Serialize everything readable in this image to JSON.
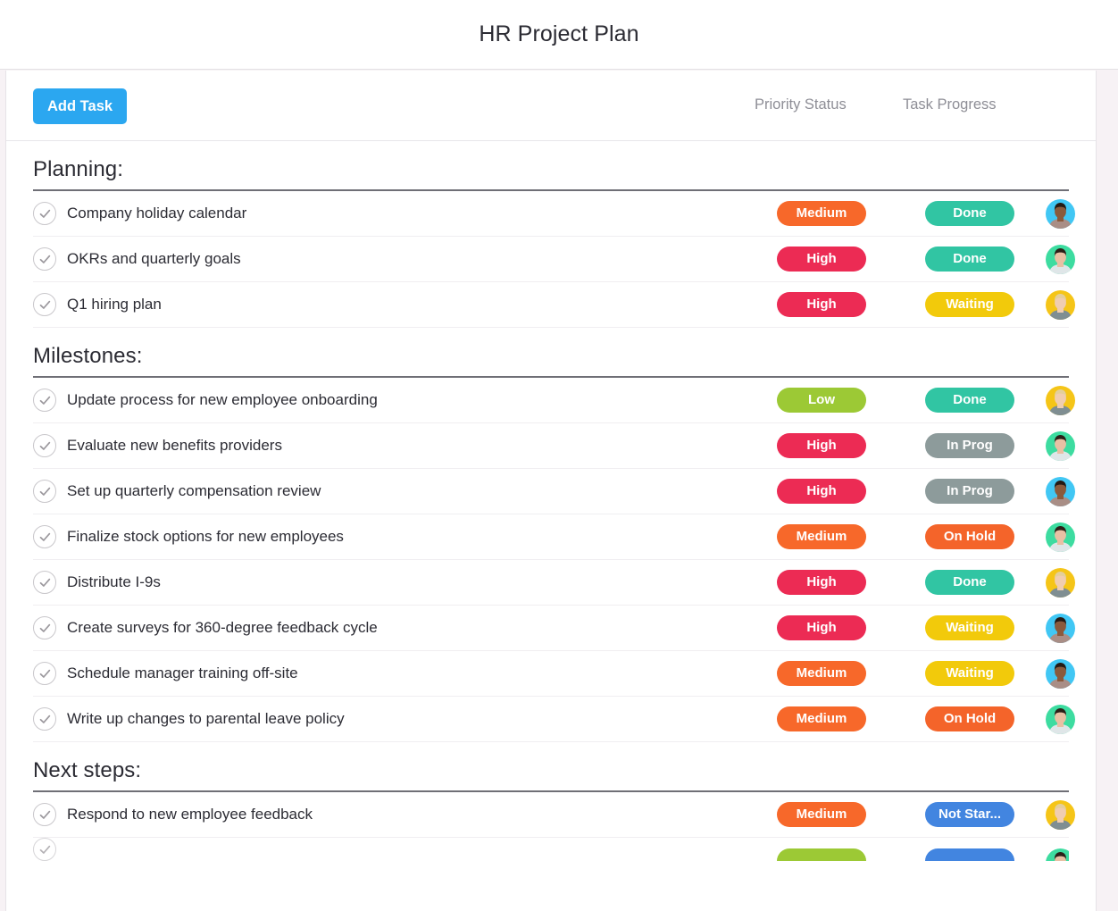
{
  "window": {
    "title": "HR Project Plan"
  },
  "toolbar": {
    "add_task_label": "Add Task",
    "column_priority": "Priority Status",
    "column_progress": "Task Progress"
  },
  "icons": {
    "check": "check-circle-icon"
  },
  "palette": {
    "accent_blue": "#2ba7f0",
    "priority_high": "#ec2b54",
    "priority_medium": "#f7682a",
    "priority_low": "#9cc935",
    "status_done": "#31c5a3",
    "status_waiting": "#f2ca0b",
    "status_in_prog": "#8d9b9b",
    "status_on_hold": "#f4642a",
    "status_not_started": "#4285e0",
    "text_primary": "#2c2c34",
    "text_muted": "#8e8e96",
    "rule_dark": "#6f6f76",
    "page_bg": "#f7f2f5"
  },
  "sections": [
    {
      "title": "Planning:",
      "rows": [
        {
          "task": "Company holiday calendar",
          "priority": "Medium",
          "priority_color": "#f7682a",
          "progress": "Done",
          "progress_color": "#31c5a3",
          "avatar": {
            "bg": "#41c7f4",
            "skin": "#8a5a3c",
            "hair": "#241a14",
            "shirt": "#a98e86"
          }
        },
        {
          "task": "OKRs and quarterly goals",
          "priority": "High",
          "priority_color": "#ec2b54",
          "progress": "Done",
          "progress_color": "#31c5a3",
          "avatar": {
            "bg": "#3ddca0",
            "skin": "#e8c0a4",
            "hair": "#2b2018",
            "shirt": "#dfe6e8"
          }
        },
        {
          "task": "Q1 hiring plan",
          "priority": "High",
          "priority_color": "#ec2b54",
          "progress": "Waiting",
          "progress_color": "#f2ca0b",
          "avatar": {
            "bg": "#f5c518",
            "skin": "#f0cdb0",
            "hair": "#e4cf9a",
            "shirt": "#7f8e92"
          }
        }
      ]
    },
    {
      "title": "Milestones:",
      "rows": [
        {
          "task": "Update process for new employee onboarding",
          "priority": "Low",
          "priority_color": "#9cc935",
          "progress": "Done",
          "progress_color": "#31c5a3",
          "avatar": {
            "bg": "#f5c518",
            "skin": "#f0cdb0",
            "hair": "#e4cf9a",
            "shirt": "#7f8e92"
          }
        },
        {
          "task": "Evaluate new benefits providers",
          "priority": "High",
          "priority_color": "#ec2b54",
          "progress": "In Prog",
          "progress_color": "#8d9b9b",
          "avatar": {
            "bg": "#3ddca0",
            "skin": "#e8c0a4",
            "hair": "#2b2018",
            "shirt": "#dfe6e8"
          }
        },
        {
          "task": "Set up quarterly compensation review",
          "priority": "High",
          "priority_color": "#ec2b54",
          "progress": "In Prog",
          "progress_color": "#8d9b9b",
          "avatar": {
            "bg": "#41c7f4",
            "skin": "#8a5a3c",
            "hair": "#241a14",
            "shirt": "#a98e86"
          }
        },
        {
          "task": "Finalize stock options for new employees",
          "priority": "Medium",
          "priority_color": "#f7682a",
          "progress": "On Hold",
          "progress_color": "#f4642a",
          "avatar": {
            "bg": "#3ddca0",
            "skin": "#e8c0a4",
            "hair": "#2b2018",
            "shirt": "#dfe6e8"
          }
        },
        {
          "task": "Distribute I-9s",
          "priority": "High",
          "priority_color": "#ec2b54",
          "progress": "Done",
          "progress_color": "#31c5a3",
          "avatar": {
            "bg": "#f5c518",
            "skin": "#f0cdb0",
            "hair": "#e4cf9a",
            "shirt": "#7f8e92"
          }
        },
        {
          "task": "Create surveys for 360-degree feedback cycle",
          "priority": "High",
          "priority_color": "#ec2b54",
          "progress": "Waiting",
          "progress_color": "#f2ca0b",
          "avatar": {
            "bg": "#41c7f4",
            "skin": "#8a5a3c",
            "hair": "#241a14",
            "shirt": "#a98e86"
          }
        },
        {
          "task": "Schedule manager training off-site",
          "priority": "Medium",
          "priority_color": "#f7682a",
          "progress": "Waiting",
          "progress_color": "#f2ca0b",
          "avatar": {
            "bg": "#41c7f4",
            "skin": "#8a5a3c",
            "hair": "#241a14",
            "shirt": "#a98e86"
          }
        },
        {
          "task": "Write up changes to parental leave policy",
          "priority": "Medium",
          "priority_color": "#f7682a",
          "progress": "On Hold",
          "progress_color": "#f4642a",
          "avatar": {
            "bg": "#3ddca0",
            "skin": "#e8c0a4",
            "hair": "#2b2018",
            "shirt": "#dfe6e8"
          }
        }
      ]
    },
    {
      "title": "Next steps:",
      "rows": [
        {
          "task": "Respond to new employee feedback",
          "priority": "Medium",
          "priority_color": "#f7682a",
          "progress": "Not Star...",
          "progress_color": "#4285e0",
          "avatar": {
            "bg": "#f5c518",
            "skin": "#f0cdb0",
            "hair": "#e4cf9a",
            "shirt": "#7f8e92"
          }
        },
        {
          "task": "",
          "priority": "",
          "priority_color": "#9cc935",
          "progress": "",
          "progress_color": "#4285e0",
          "avatar": {
            "bg": "#3ddca0",
            "skin": "#e8c0a4",
            "hair": "#2b2018",
            "shirt": "#dfe6e8"
          },
          "cut": true
        }
      ]
    }
  ]
}
